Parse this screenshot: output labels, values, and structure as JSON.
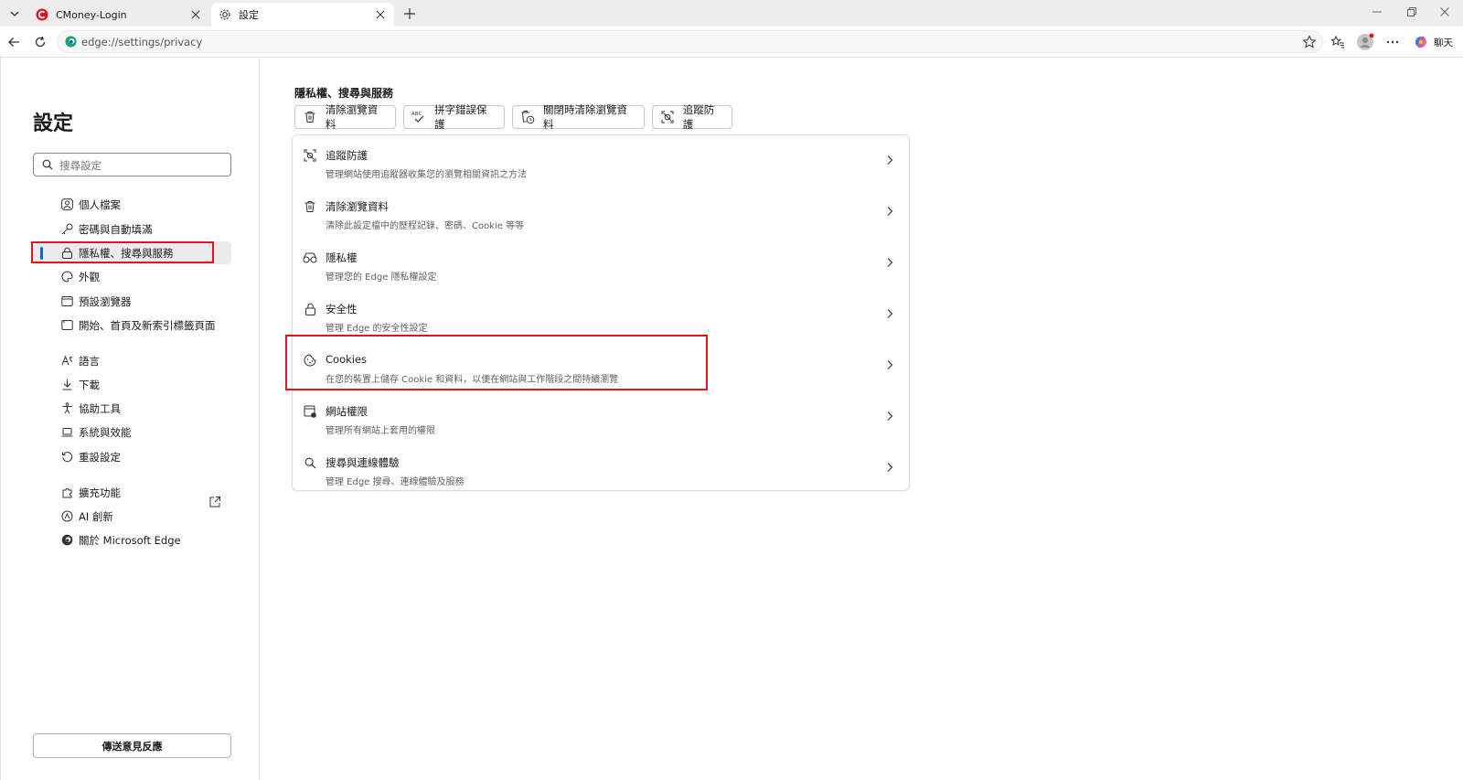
{
  "tabs": [
    {
      "title": "CMoney-Login",
      "icon": "cmoney-favicon"
    },
    {
      "title": "設定",
      "icon": "gear-icon"
    }
  ],
  "address": {
    "url": "edge://settings/privacy"
  },
  "toolbar": {
    "chat_label": "聊天"
  },
  "sidebar": {
    "title": "設定",
    "search_placeholder": "搜尋設定",
    "items": [
      {
        "label": "個人檔案",
        "icon": "profile-icon"
      },
      {
        "label": "密碼與自動填滿",
        "icon": "key-icon"
      },
      {
        "label": "隱私權、搜尋與服務",
        "icon": "lock-icon",
        "active": true
      },
      {
        "label": "外觀",
        "icon": "palette-icon"
      },
      {
        "label": "預設瀏覽器",
        "icon": "browser-icon"
      },
      {
        "label": "開始、首頁及新索引標籤頁面",
        "icon": "home-icon"
      },
      {
        "label": "語言",
        "icon": "language-icon"
      },
      {
        "label": "下載",
        "icon": "download-icon"
      },
      {
        "label": "協助工具",
        "icon": "accessibility-icon"
      },
      {
        "label": "系統與效能",
        "icon": "laptop-icon"
      },
      {
        "label": "重設設定",
        "icon": "reset-icon"
      },
      {
        "label": "擴充功能",
        "icon": "extension-icon"
      },
      {
        "label": "AI 創新",
        "icon": "ai-icon"
      },
      {
        "label": "關於 Microsoft Edge",
        "icon": "edge-icon"
      }
    ],
    "feedback_label": "傳送意見反應"
  },
  "main": {
    "section_title": "隱私權、搜尋與服務",
    "chips": [
      {
        "label": "清除瀏覽資料",
        "icon": "trash-icon"
      },
      {
        "label": "拼字錯誤保護",
        "icon": "spellcheck-icon"
      },
      {
        "label": "關閉時清除瀏覽資料",
        "icon": "trash-clock-icon"
      },
      {
        "label": "追蹤防護",
        "icon": "tracking-icon"
      }
    ],
    "rows": [
      {
        "title": "追蹤防護",
        "subtitle": "管理網站使用追蹤器收集您的瀏覽相關資訊之方法",
        "icon": "tracking-icon"
      },
      {
        "title": "清除瀏覽資料",
        "subtitle": "清除此設定檔中的歷程記錄、密碼、Cookie 等等",
        "icon": "trash-icon"
      },
      {
        "title": "隱私權",
        "subtitle": "管理您的 Edge 隱私權設定",
        "icon": "glasses-icon"
      },
      {
        "title": "安全性",
        "subtitle": "管理 Edge 的安全性設定",
        "icon": "lock-icon"
      },
      {
        "title": "Cookies",
        "subtitle": "在您的裝置上儲存 Cookie 和資料，以便在網站與工作階段之間持續瀏覽",
        "icon": "cookie-icon"
      },
      {
        "title": "網站權限",
        "subtitle": "管理所有網站上套用的權限",
        "icon": "site-permissions-icon"
      },
      {
        "title": "搜尋與連線體驗",
        "subtitle": "管理 Edge 搜尋、連線體驗及服務",
        "icon": "search-icon"
      }
    ]
  },
  "colors": {
    "accent": "#0f6cbd",
    "highlight": "#e0161c"
  }
}
